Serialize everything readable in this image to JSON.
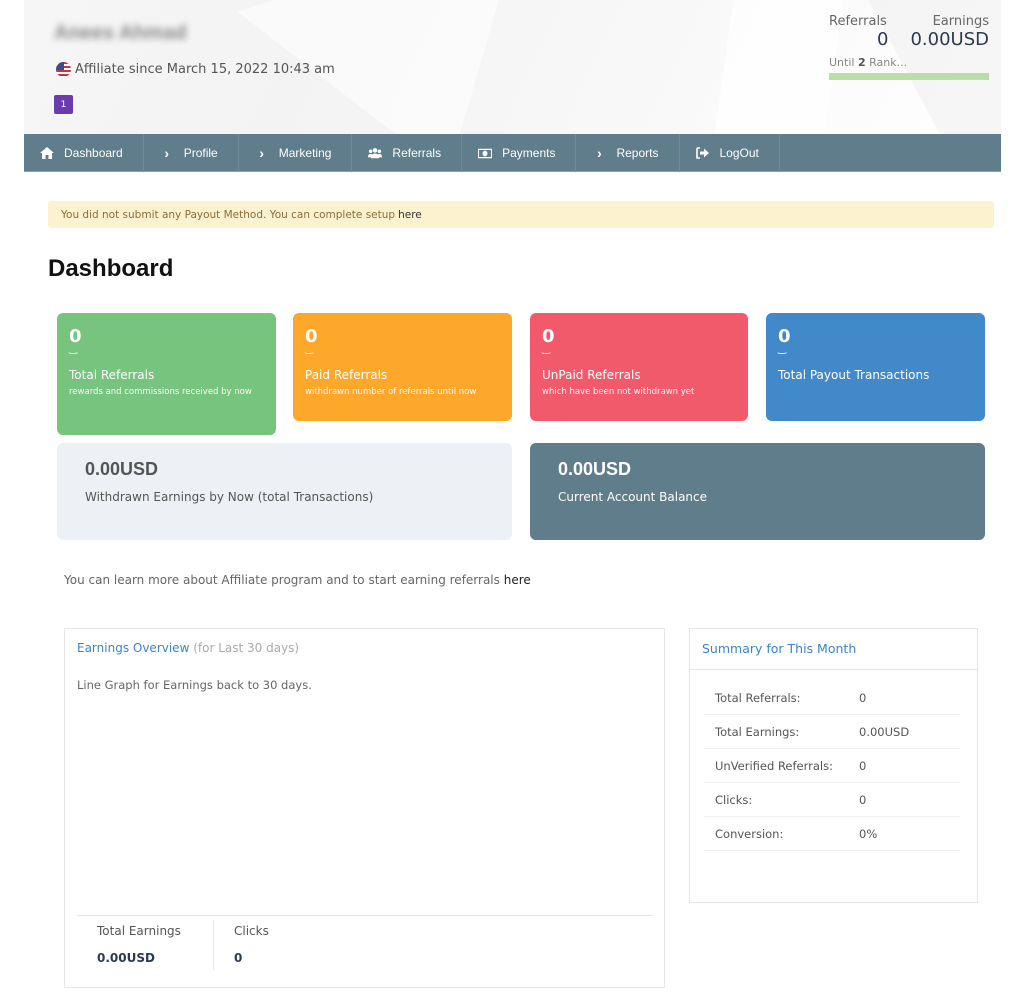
{
  "header": {
    "user_name": "Anees Ahmad",
    "affiliate_since": "Affiliate since March 15, 2022 10:43 am",
    "rank_badge": "1",
    "stats": {
      "referrals_label": "Referrals",
      "earnings_label": "Earnings",
      "referrals_value": "0",
      "earnings_value": "0.00USD",
      "rank_prefix": "Until",
      "rank_number": "2",
      "rank_suffix": "Rank...",
      "rank_progress": 1.0,
      "rank_bar_color": "#b8dfa9"
    }
  },
  "navbar": {
    "items": [
      {
        "label": "Dashboard",
        "icon": "home-icon"
      },
      {
        "label": "Profile",
        "icon": "chevron-right-icon"
      },
      {
        "label": "Marketing",
        "icon": "chevron-right-icon"
      },
      {
        "label": "Referrals",
        "icon": "users-icon"
      },
      {
        "label": "Payments",
        "icon": "money-icon"
      },
      {
        "label": "Reports",
        "icon": "chevron-right-icon"
      },
      {
        "label": "LogOut",
        "icon": "sign-out-icon"
      }
    ],
    "color": "#607d8b"
  },
  "alert": {
    "text": "You did not submit any Payout Method. You can complete setup",
    "link": "here"
  },
  "page_title": "Dashboard",
  "cards": [
    {
      "value": "0",
      "title": "Total Referrals",
      "desc": "rewards and commissions received by now",
      "color": "#76c47d"
    },
    {
      "value": "0",
      "title": "Paid Referrals",
      "desc": "withdrawn number of referrals until now",
      "color": "#fea82b"
    },
    {
      "value": "0",
      "title": "UnPaid Referrals",
      "desc": "which have been not withdrawn yet",
      "color": "#f15a6b"
    },
    {
      "value": "0",
      "title": "Total Payout Transactions",
      "desc": "",
      "color": "#4189c9"
    }
  ],
  "balances": [
    {
      "amount": "0.00USD",
      "label": "Withdrawn Earnings by Now (total Transactions)"
    },
    {
      "amount": "0.00USD",
      "label": "Current Account Balance"
    }
  ],
  "learn_more": {
    "text": "You can learn more about Affiliate program and to start earning referrals",
    "link": "here"
  },
  "earnings_overview": {
    "title": "Earnings Overview",
    "subtitle": "(for Last 30 days)",
    "description": "Line Graph for Earnings back to 30 days.",
    "footer": [
      {
        "label": "Total Earnings",
        "value": "0.00USD"
      },
      {
        "label": "Clicks",
        "value": "0"
      }
    ]
  },
  "summary": {
    "title": "Summary for This Month",
    "rows": [
      {
        "key": "Total Referrals:",
        "value": "0"
      },
      {
        "key": "Total Earnings:",
        "value": "0.00USD"
      },
      {
        "key": "UnVerified Referrals:",
        "value": "0"
      },
      {
        "key": "Clicks:",
        "value": "0"
      },
      {
        "key": "Conversion:",
        "value": "0%"
      }
    ]
  }
}
